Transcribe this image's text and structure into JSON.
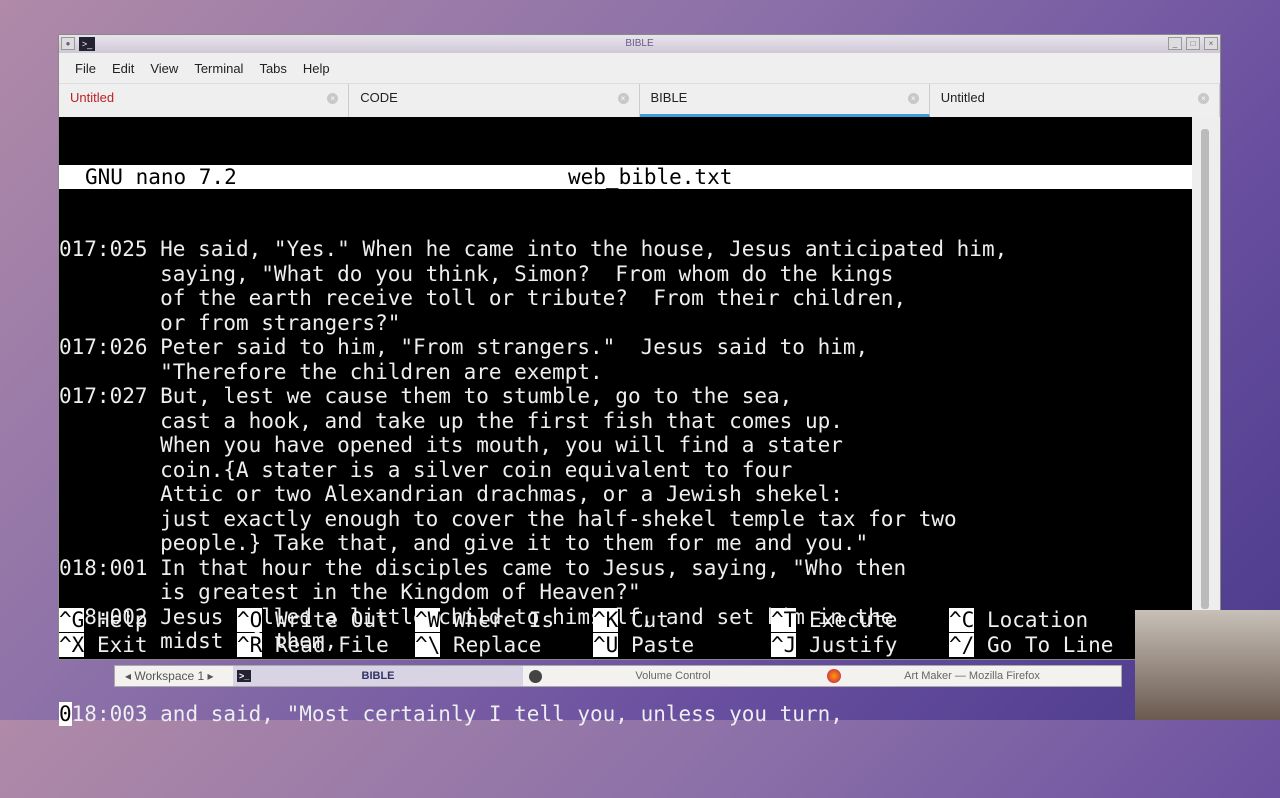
{
  "window": {
    "title": "BIBLE"
  },
  "menu": [
    "File",
    "Edit",
    "View",
    "Terminal",
    "Tabs",
    "Help"
  ],
  "tabs": [
    {
      "label": "Untitled",
      "color": "#b22222"
    },
    {
      "label": "CODE"
    },
    {
      "label": "BIBLE",
      "active": true
    },
    {
      "label": "Untitled"
    }
  ],
  "nano": {
    "version": "GNU nano 7.2",
    "filename": "web_bible.txt"
  },
  "lines": [
    "017:025 He said, \"Yes.\" When he came into the house, Jesus anticipated him,",
    "        saying, \"What do you think, Simon?  From whom do the kings",
    "        of the earth receive toll or tribute?  From their children,",
    "        or from strangers?\"",
    "017:026 Peter said to him, \"From strangers.\"  Jesus said to him,",
    "        \"Therefore the children are exempt.",
    "017:027 But, lest we cause them to stumble, go to the sea,",
    "        cast a hook, and take up the first fish that comes up.",
    "        When you have opened its mouth, you will find a stater",
    "        coin.{A stater is a silver coin equivalent to four",
    "        Attic or two Alexandrian drachmas, or a Jewish shekel:",
    "        just exactly enough to cover the half-shekel temple tax for two",
    "        people.} Take that, and give it to them for me and you.\"",
    "018:001 In that hour the disciples came to Jesus, saying, \"Who then",
    "        is greatest in the Kingdom of Heaven?\"",
    "018:002 Jesus called a little child to himself, and set him in the",
    "        midst of them,"
  ],
  "cursor_line": {
    "cursor_char": "0",
    "rest": "18:003 and said, \"Most certainly I tell you, unless you turn,"
  },
  "shortcuts": [
    [
      {
        "key": "^G",
        "label": "Help"
      },
      {
        "key": "^O",
        "label": "Write Out"
      },
      {
        "key": "^W",
        "label": "Where Is"
      },
      {
        "key": "^K",
        "label": "Cut"
      },
      {
        "key": "^T",
        "label": "Execute"
      },
      {
        "key": "^C",
        "label": "Location"
      }
    ],
    [
      {
        "key": "^X",
        "label": "Exit"
      },
      {
        "key": "^R",
        "label": "Read File"
      },
      {
        "key": "^\\",
        "label": "Replace"
      },
      {
        "key": "^U",
        "label": "Paste"
      },
      {
        "key": "^J",
        "label": "Justify"
      },
      {
        "key": "^/",
        "label": "Go To Line"
      }
    ]
  ],
  "taskbar": {
    "workspace": "Workspace 1",
    "items": [
      "BIBLE",
      "Volume Control",
      "Art Maker — Mozilla Firefox"
    ]
  }
}
